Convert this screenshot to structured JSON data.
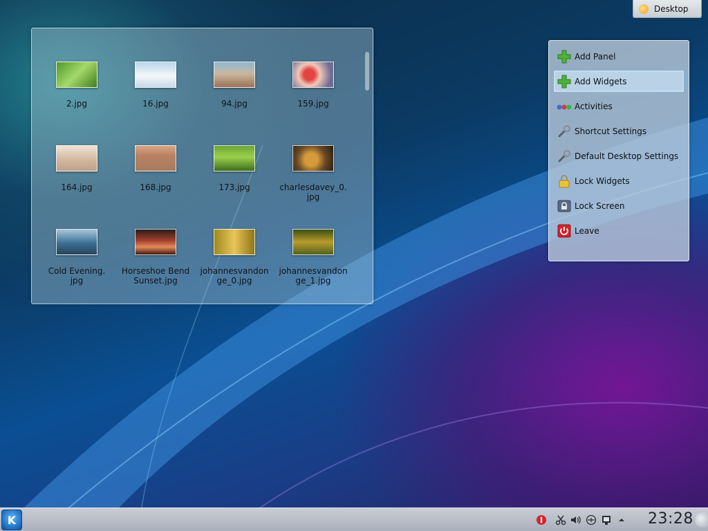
{
  "desktop": {
    "toolbox_label": "Desktop"
  },
  "folder_view": {
    "files": [
      {
        "name": "2.jpg"
      },
      {
        "name": "16.jpg"
      },
      {
        "name": "94.jpg"
      },
      {
        "name": "159.jpg"
      },
      {
        "name": "164.jpg"
      },
      {
        "name": "168.jpg"
      },
      {
        "name": "173.jpg"
      },
      {
        "name": "charlesdavey_0.\njpg"
      },
      {
        "name": "Cold Evening.\njpg"
      },
      {
        "name": "Horseshoe Bend\nSunset.jpg"
      },
      {
        "name": "johannesvandon\nge_0.jpg"
      },
      {
        "name": "johannesvandon\nge_1.jpg"
      }
    ]
  },
  "toolbox": {
    "items": [
      {
        "label": "Add Panel",
        "icon": "plus-icon"
      },
      {
        "label": "Add Widgets",
        "icon": "plus-icon"
      },
      {
        "label": "Activities",
        "icon": "activities-icon"
      },
      {
        "label": "Shortcut Settings",
        "icon": "wrench-icon"
      },
      {
        "label": "Default Desktop Settings",
        "icon": "wrench-icon"
      },
      {
        "label": "Lock Widgets",
        "icon": "lock-icon"
      },
      {
        "label": "Lock Screen",
        "icon": "lock-screen-icon"
      },
      {
        "label": "Leave",
        "icon": "power-icon"
      }
    ],
    "highlighted_item": "Add Widgets"
  },
  "panel": {
    "kicker_letter": "K",
    "clock": "23:28"
  },
  "colors": {
    "accent": "#1c6fc3",
    "highlight_border": "#7fb0d8",
    "power_red": "#d3232a",
    "plus_green": "#4cb23a"
  }
}
